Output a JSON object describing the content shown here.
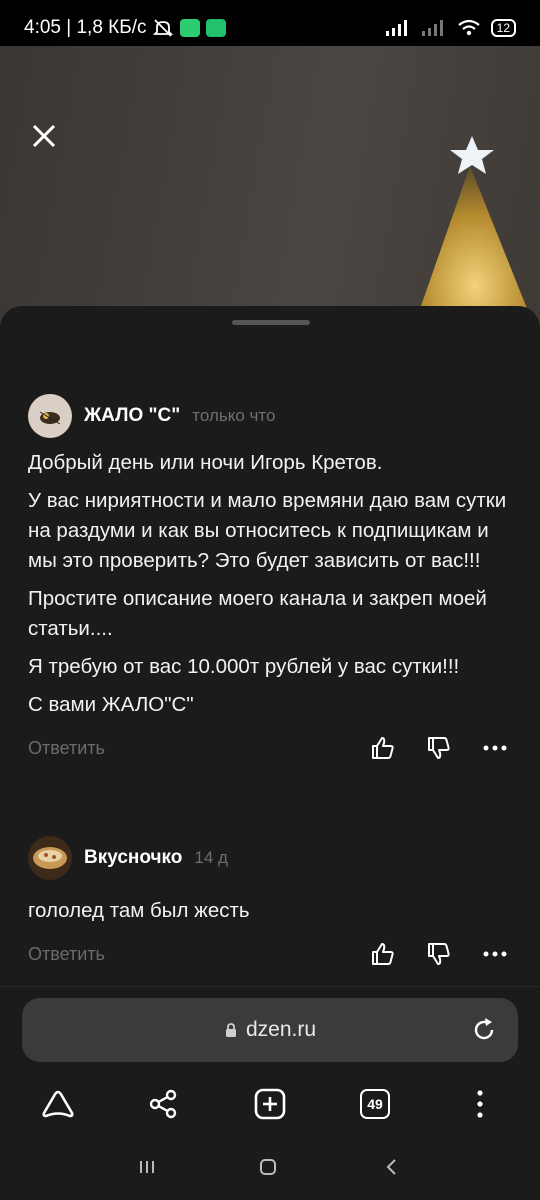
{
  "status_bar": {
    "time_speed": "4:05 | 1,8 КБ/с",
    "battery": "12"
  },
  "comments": [
    {
      "author": "ЖАЛО \"С\"",
      "time": "только что",
      "paragraphs": [
        "Добрый день или ночи Игорь Кретов.",
        "У вас нириятности и мало времяни даю вам сутки на раздуми и как вы относитесь к подпищикам и мы это проверить? Это будет зависить от вас!!!",
        "Простите описание моего канала и закреп моей статьи....",
        "Я требую от вас 10.000т рублей у вас сутки!!!",
        "С вами ЖАЛО\"С\""
      ],
      "reply_label": "Ответить"
    },
    {
      "author": "Вкусночко",
      "time": "14 д",
      "paragraphs": [
        "гололед там был жесть"
      ],
      "reply_label": "Ответить"
    }
  ],
  "browser": {
    "url": "dzen.ru",
    "tabs_count": "49"
  },
  "icons": {
    "close": "close-icon",
    "like": "thumbs-up-icon",
    "dislike": "thumbs-down-icon",
    "more": "more-horizontal-icon",
    "lock": "lock-icon",
    "reload": "reload-icon",
    "home": "alice-home-icon",
    "share": "share-icon",
    "new_tab": "plus-square-icon",
    "menu": "more-vertical-icon"
  },
  "colors": {
    "background": "#1b1b1b",
    "muted_text": "#6b6b6b",
    "url_bar": "#3b3b3b"
  }
}
